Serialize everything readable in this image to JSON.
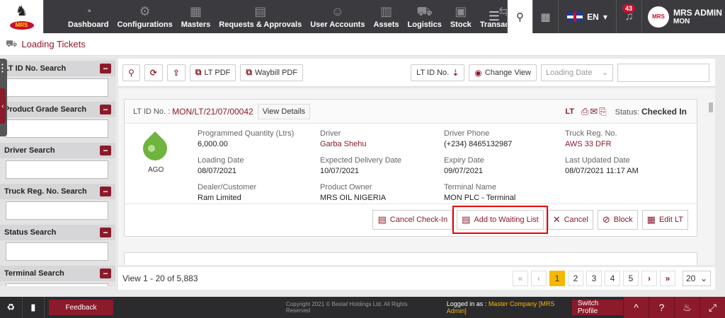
{
  "nav": {
    "items": [
      {
        "label": "Dashboard",
        "icon": "dashboard-icon",
        "glyph": "◔"
      },
      {
        "label": "Configurations",
        "icon": "gears-icon",
        "glyph": "⚙"
      },
      {
        "label": "Masters",
        "icon": "building-icon",
        "glyph": "▦"
      },
      {
        "label": "Requests & Approvals",
        "icon": "document-check-icon",
        "glyph": "▤"
      },
      {
        "label": "User Accounts",
        "icon": "users-icon",
        "glyph": "☺"
      },
      {
        "label": "Assets",
        "icon": "assets-icon",
        "glyph": "▥"
      },
      {
        "label": "Logistics",
        "icon": "truck-icon",
        "glyph": "⛟"
      },
      {
        "label": "Stock",
        "icon": "database-icon",
        "glyph": "▣"
      },
      {
        "label": "Transactions",
        "icon": "transactions-icon",
        "glyph": "⇆"
      }
    ],
    "language": "EN",
    "notification_count": "43",
    "user_name": "MRS ADMIN",
    "user_role": "MON"
  },
  "page": {
    "title": "Loading Tickets"
  },
  "sidebar": {
    "filters": [
      {
        "label": "LT ID No. Search"
      },
      {
        "label": "Product Grade Search"
      },
      {
        "label": "Driver Search"
      },
      {
        "label": "Truck Reg. No. Search"
      },
      {
        "label": "Status Search"
      },
      {
        "label": "Terminal Search"
      }
    ]
  },
  "toolbar": {
    "lt_pdf": "LT PDF",
    "waybill_pdf": "Waybill PDF",
    "sort_label": "LT ID No.",
    "change_view": "Change View",
    "sort_select": "Loading Date"
  },
  "ticket": {
    "id_label": "LT ID No. :",
    "id": "MON/LT/21/07/00042",
    "view_details": "View Details",
    "lt_label": "LT",
    "status_label": "Status:",
    "status": "Checked In",
    "product": "AGO",
    "fields": {
      "programmed_qty_label": "Programmed Quantity (Ltrs)",
      "programmed_qty": "6,000.00",
      "driver_label": "Driver",
      "driver": "Garba Shehu",
      "driver_phone_label": "Driver Phone",
      "driver_phone": "(+234) 8465132987",
      "truck_label": "Truck Reg. No.",
      "truck": "AWS 33 DFR",
      "loading_date_label": "Loading Date",
      "loading_date": "08/07/2021",
      "expected_delivery_label": "Expected Delivery Date",
      "expected_delivery": "10/07/2021",
      "expiry_label": "Expiry Date",
      "expiry": "09/07/2021",
      "last_updated_label": "Last Updated Date",
      "last_updated": "08/07/2021 11:17 AM",
      "dealer_label": "Dealer/Customer",
      "dealer": "Ram Limited",
      "owner_label": "Product Owner",
      "owner": "MRS OIL NIGERIA",
      "terminal_label": "Terminal Name",
      "terminal": "MON PLC - Terminal"
    },
    "actions": {
      "cancel_checkin": "Cancel Check-In",
      "add_waiting": "Add to Waiting List",
      "cancel": "Cancel",
      "block": "Block",
      "edit": "Edit LT"
    }
  },
  "pager": {
    "summary": "View 1 - 20 of 5,883",
    "pages": [
      "1",
      "2",
      "3",
      "4",
      "5"
    ],
    "active_page": "1",
    "per_page": "20"
  },
  "footer": {
    "feedback": "Feedback",
    "copyright": "Copyright 2021 © Bestaf Holdings Ltd. All Rights Reserved",
    "logged_in_label": "Logged in as :",
    "logged_in_company": "Master Company [MRS Admin]",
    "switch_profile": "Switch Profile"
  },
  "colors": {
    "brand": "#8b1a2b",
    "nav_bg": "#3b3b3f",
    "active_page": "#f5b800",
    "product_drop": "#6fb43f"
  }
}
